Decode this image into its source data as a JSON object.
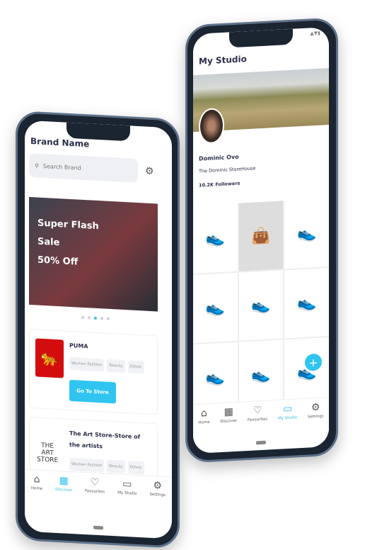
{
  "left": {
    "title": "Brand Name",
    "search_placeholder": "Search Brand",
    "banner": [
      "Super Flash",
      "Sale",
      "50% Off"
    ],
    "stores": [
      {
        "name": "PUMA",
        "tags": [
          "Women Fashion",
          "Beauty",
          "Ethnic"
        ],
        "button": "Go To Store"
      },
      {
        "name": "The Art Store-Store of the artists",
        "logo": [
          "THE",
          "ART",
          "STORE"
        ],
        "tags": [
          "Women Fashion",
          "Beauty",
          "Ethnic"
        ]
      }
    ]
  },
  "nav": [
    "Home",
    "Discover",
    "Favourites",
    "My Studio",
    "Settings"
  ],
  "right": {
    "title": "My Studio",
    "profile_name": "Dominic Ovo",
    "store": "The Dominic StoreHouse",
    "followers": "10.2K Followers"
  },
  "colors": {
    "accent": "#2fc5f0"
  }
}
